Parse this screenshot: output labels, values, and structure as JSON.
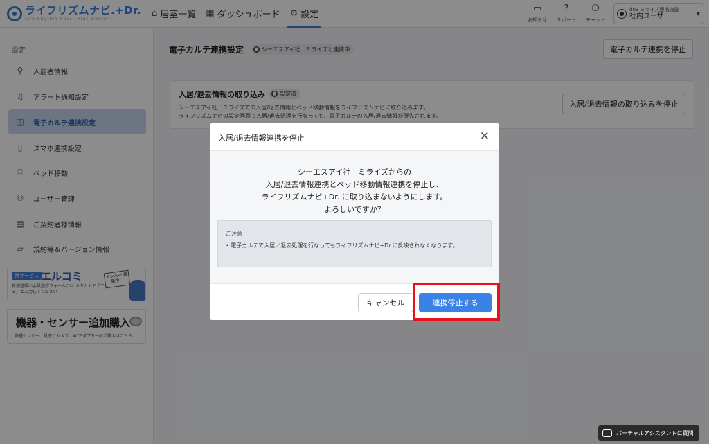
{
  "app": {
    "logo": "ライフリズムナビ.+Dr.",
    "logo_sub": "Life Rhythm Navi · Plus Doctor"
  },
  "nav": [
    {
      "label": "居室一覧",
      "icon": "home-icon",
      "glyph": "⌂"
    },
    {
      "label": "ダッシュボード",
      "icon": "dashboard-icon",
      "glyph": "▦"
    },
    {
      "label": "設定",
      "icon": "gear-icon",
      "glyph": "⚙"
    }
  ],
  "header_buttons": [
    {
      "label": "お知らせ",
      "icon": "message-icon",
      "glyph": "▭"
    },
    {
      "label": "サポート",
      "icon": "help-icon",
      "glyph": "?"
    },
    {
      "label": "チャット",
      "icon": "chat-icon",
      "glyph": "❍"
    }
  ],
  "user": {
    "facility": "d03 ミライズ連携施設",
    "name": "社内ユーザ"
  },
  "sidebar": {
    "title": "設定",
    "items": [
      {
        "label": "入居者情報",
        "icon": "resident-icon",
        "glyph": "⚲"
      },
      {
        "label": "アラート通知設定",
        "icon": "bell-icon",
        "glyph": "♫"
      },
      {
        "label": "電子カルテ連携設定",
        "icon": "chart-link-icon",
        "glyph": "◫"
      },
      {
        "label": "スマホ連携設定",
        "icon": "smartphone-icon",
        "glyph": "▯"
      },
      {
        "label": "ベッド移動",
        "icon": "bed-icon",
        "glyph": "⌸"
      },
      {
        "label": "ユーザー管理",
        "icon": "users-icon",
        "glyph": "⚇"
      },
      {
        "label": "ご契約者様情報",
        "icon": "contract-icon",
        "glyph": "▤"
      },
      {
        "label": "規約等＆バージョン情報",
        "icon": "document-icon",
        "glyph": "▱"
      }
    ],
    "active_index": 2
  },
  "banner1": {
    "tag": "新サービス",
    "title": "エルコミ",
    "text": "新規登録の会員登録フォームには カタカナで「エルコミ」と入力してください",
    "sign": "メンバー 募集中！"
  },
  "banner2": {
    "title": "機器・センサー追加購入",
    "text": "各種センサー、見守りカメラ、ACアダプターのご購入はこちら"
  },
  "main": {
    "title": "電子カルテ連携設定",
    "status_badge": "シーエスアイ社　ミライズと連携中",
    "stop_button": "電子カルテ連携を停止",
    "card": {
      "title": "入居/退去情報の取り込み",
      "badge": "設定済",
      "desc1": "シーエスアイ社　ミライズでの入居/退去情報とベッド移動情報をライフリズムナビに取り込みます。",
      "desc2": "ライフリズムナビの設定画面で入居/退去処理を行なっても、電子カルテの入居/退去情報が優先されます。",
      "stop_button": "入居/退去情報の取り込みを停止"
    }
  },
  "modal": {
    "title": "入居/退去情報連携を停止",
    "message_lines": [
      "シーエスアイ社　ミライズからの",
      "入居/退去情報連携とベッド移動情報連携を停止し、",
      "ライフリズムナビ+Dr. に取り込まないようにします。",
      "よろしいですか？"
    ],
    "notice_title": "ご注意",
    "notice_item": "• 電子カルテで入居／退去処理を行なってもライフリズムナビ+Dr.に反映されなくなります。",
    "cancel": "キャンセル",
    "confirm": "連携停止する"
  },
  "assistant": {
    "label": "バーチャルアシスタントに質問"
  },
  "colors": {
    "accent": "#3b82e6",
    "highlight": "#e8101c",
    "sidebar_active": "#c7d6ee"
  }
}
